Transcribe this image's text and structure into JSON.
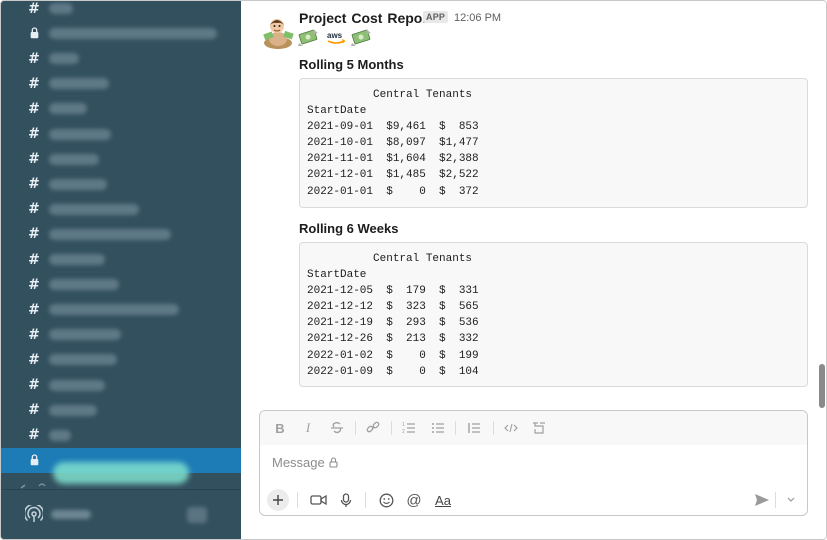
{
  "sidebar": {
    "channels": [
      {
        "type": "hash",
        "top": 0
      },
      {
        "type": "lock"
      },
      {
        "type": "hash"
      },
      {
        "type": "hash"
      },
      {
        "type": "hash"
      },
      {
        "type": "hash"
      },
      {
        "type": "hash"
      },
      {
        "type": "hash"
      },
      {
        "type": "hash"
      },
      {
        "type": "hash"
      },
      {
        "type": "hash"
      },
      {
        "type": "hash"
      },
      {
        "type": "hash"
      },
      {
        "type": "hash"
      },
      {
        "type": "hash"
      },
      {
        "type": "hash"
      },
      {
        "type": "hash"
      },
      {
        "type": "hash"
      },
      {
        "type": "lock",
        "selected": true
      }
    ],
    "hash_glyph": "#"
  },
  "message": {
    "sender": "Project Cost Report",
    "badge": "APP",
    "timestamp": "12:06 PM",
    "reactions": [
      "money-icon",
      "aws-icon",
      "money-icon"
    ],
    "aws_text": "aws",
    "sections": [
      {
        "title": "Rolling 5 Months",
        "code": "          Central Tenants\nStartDate\n2021-09-01  $9,461  $  853\n2021-10-01  $8,097  $1,477\n2021-11-01  $1,604  $2,388\n2021-12-01  $1,485  $2,522\n2022-01-01  $    0  $  372"
      },
      {
        "title": "Rolling 6 Weeks",
        "code": "          Central Tenants\nStartDate\n2021-12-05  $  179  $  331\n2021-12-12  $  323  $  565\n2021-12-19  $  293  $  536\n2021-12-26  $  213  $  332\n2022-01-02  $    0  $  199\n2022-01-09  $    0  $  104"
      }
    ]
  },
  "composer": {
    "placeholder": "Message",
    "format_buttons": [
      "B",
      "I"
    ],
    "aa_label": "Aa",
    "at_label": "@"
  },
  "colors": {
    "sidebar_bg": "#33505f",
    "selected_bg": "#1d7bb5",
    "accent": "#1264a3"
  }
}
